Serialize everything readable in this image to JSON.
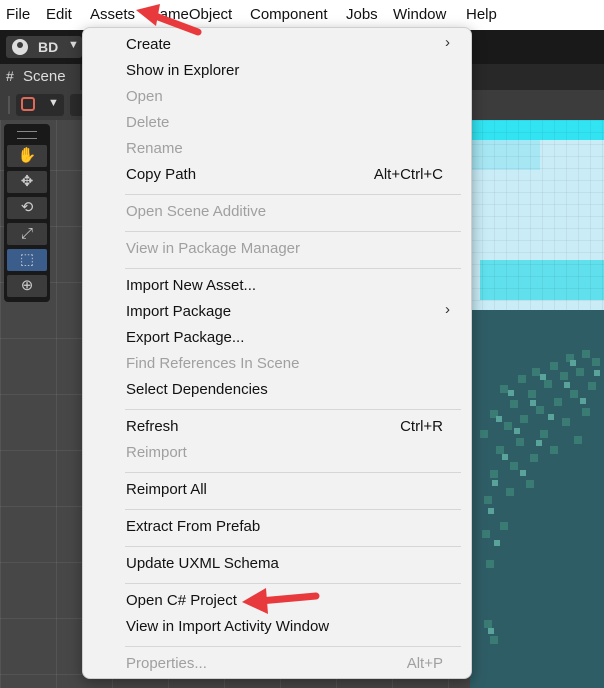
{
  "menubar": {
    "items": [
      "File",
      "Edit",
      "Assets",
      "GameObject",
      "Component",
      "Jobs",
      "Window",
      "Help"
    ]
  },
  "toolbar": {
    "account_label": "BD"
  },
  "scene_tab": {
    "label": "Scene"
  },
  "assets_menu": {
    "items": [
      {
        "label": "Create",
        "submenu": true
      },
      {
        "label": "Show in Explorer"
      },
      {
        "label": "Open",
        "disabled": true
      },
      {
        "label": "Delete",
        "disabled": true
      },
      {
        "label": "Rename",
        "disabled": true
      },
      {
        "label": "Copy Path",
        "shortcut": "Alt+Ctrl+C"
      },
      {
        "label": "Open Scene Additive",
        "disabled": true
      },
      {
        "label": "View in Package Manager",
        "disabled": true
      },
      {
        "label": "Import New Asset..."
      },
      {
        "label": "Import Package",
        "submenu": true
      },
      {
        "label": "Export Package..."
      },
      {
        "label": "Find References In Scene",
        "disabled": true
      },
      {
        "label": "Select Dependencies"
      },
      {
        "label": "Refresh",
        "shortcut": "Ctrl+R"
      },
      {
        "label": "Reimport",
        "disabled": true
      },
      {
        "label": "Reimport All"
      },
      {
        "label": "Extract From Prefab"
      },
      {
        "label": "Update UXML Schema"
      },
      {
        "label": "Open C# Project"
      },
      {
        "label": "View in Import Activity Window"
      },
      {
        "label": "Properties...",
        "shortcut": "Alt+P",
        "disabled": true
      }
    ]
  },
  "tools": [
    "hand-tool",
    "move-tool",
    "rotate-tool",
    "scale-tool",
    "rect-tool",
    "transform-tool"
  ],
  "colors": {
    "annotation_arrow": "#e8393c",
    "menu_background": "#f2f2f2",
    "disabled_text": "#a0a0a0",
    "editor_dark": "#191919",
    "active_tool": "#3a5d8c"
  }
}
